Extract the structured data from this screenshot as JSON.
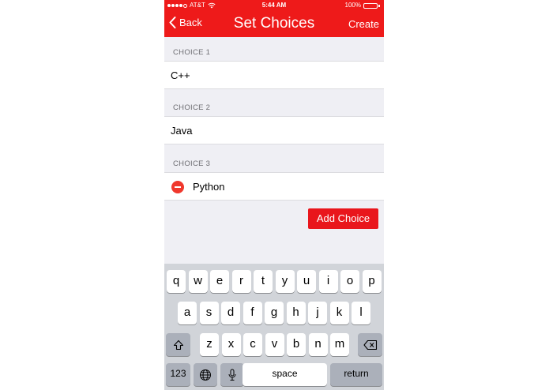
{
  "status_bar": {
    "carrier": "AT&T",
    "time": "5:44 AM",
    "battery": "100%",
    "battery_level": 1.0,
    "signal_bars_filled": 4,
    "signal_bars_total": 5
  },
  "nav": {
    "back_label": "Back",
    "title": "Set Choices",
    "create_label": "Create"
  },
  "sections": [
    {
      "header": "CHOICE 1",
      "value": "C++"
    },
    {
      "header": "CHOICE 2",
      "value": "Java"
    },
    {
      "header": "CHOICE 3",
      "value": "Python"
    }
  ],
  "add_choice_label": "Add Choice",
  "keyboard": {
    "row1": [
      "q",
      "w",
      "e",
      "r",
      "t",
      "y",
      "u",
      "i",
      "o",
      "p"
    ],
    "row2": [
      "a",
      "s",
      "d",
      "f",
      "g",
      "h",
      "j",
      "k",
      "l"
    ],
    "row3": [
      "z",
      "x",
      "c",
      "v",
      "b",
      "n",
      "m"
    ],
    "numbers_label": "123",
    "space_label": "space",
    "return_label": "return"
  },
  "colors": {
    "accent": "#ee1a1a",
    "delete": "#f0382d",
    "background": "#efeff4"
  },
  "icons": {
    "back": "chevron-left-icon",
    "delete": "minus-circle-icon",
    "shift": "shift-icon",
    "backspace": "backspace-icon",
    "globe": "globe-icon",
    "mic": "microphone-icon"
  }
}
